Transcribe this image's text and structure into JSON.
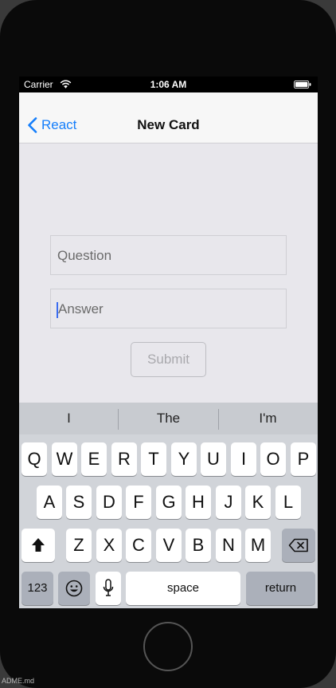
{
  "status_bar": {
    "carrier": "Carrier",
    "time": "1:06 AM"
  },
  "nav": {
    "back_label": "React",
    "title": "New Card"
  },
  "form": {
    "question_placeholder": "Question",
    "answer_placeholder": "Answer",
    "submit_label": "Submit"
  },
  "keyboard": {
    "suggestions": [
      "I",
      "The",
      "I'm"
    ],
    "row1": [
      "Q",
      "W",
      "E",
      "R",
      "T",
      "Y",
      "U",
      "I",
      "O",
      "P"
    ],
    "row2": [
      "A",
      "S",
      "D",
      "F",
      "G",
      "H",
      "J",
      "K",
      "L"
    ],
    "row3": [
      "Z",
      "X",
      "C",
      "V",
      "B",
      "N",
      "M"
    ],
    "numbers_key": "123",
    "space_key": "space",
    "return_key": "return"
  },
  "bottom_strip_text": "ADME.md"
}
